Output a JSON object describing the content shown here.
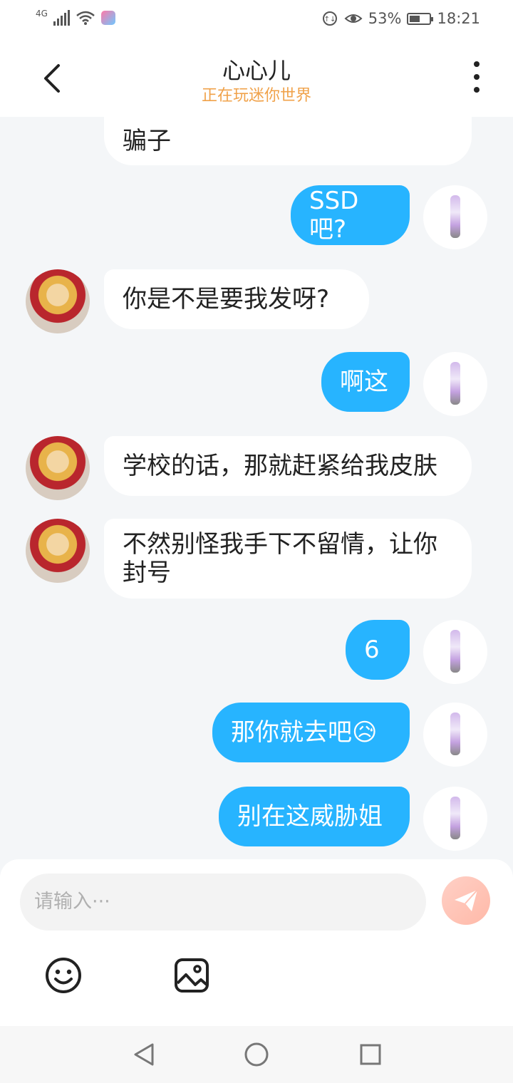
{
  "status_bar": {
    "network": "4G",
    "battery": "53%",
    "battery_level": 0.53,
    "time": "18:21"
  },
  "header": {
    "title": "心心儿",
    "subtitle": "正在玩迷你世界"
  },
  "messages": [
    {
      "from": "them",
      "text": "骗子"
    },
    {
      "from": "me",
      "text": "SSD吧?"
    },
    {
      "from": "them",
      "text": "你是不是要我发呀?"
    },
    {
      "from": "me",
      "text": "啊这"
    },
    {
      "from": "them",
      "text": "学校的话，那就赶紧给我皮肤"
    },
    {
      "from": "them",
      "text": "不然别怪我手下不留情，让你封号"
    },
    {
      "from": "me",
      "text": "6"
    },
    {
      "from": "me",
      "text": "那你就去吧😥"
    },
    {
      "from": "me",
      "text": "别在这威胁姐"
    }
  ],
  "composer": {
    "placeholder": "请输入···"
  },
  "icons": {
    "back": "chevron-left-icon",
    "more": "more-vertical-icon",
    "send": "paper-plane-icon",
    "emoji": "smiley-icon",
    "image": "image-icon"
  },
  "colors": {
    "outgoing_bubble": "#27b4ff",
    "incoming_bubble": "#ffffff",
    "subtitle": "#f0a24a",
    "background": "#f4f6f8"
  }
}
